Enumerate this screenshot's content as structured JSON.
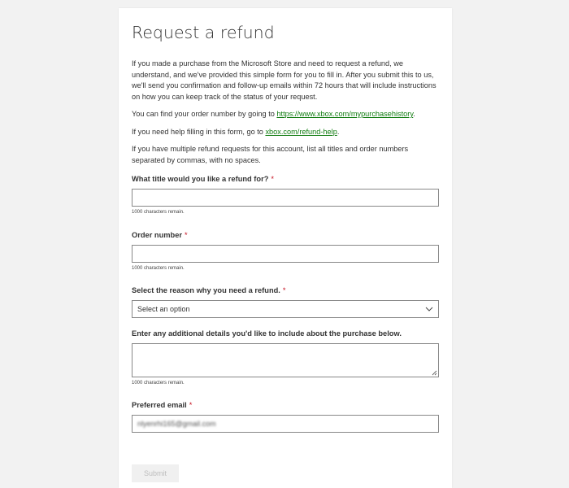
{
  "form": {
    "title": "Request a refund",
    "intro": {
      "p1": "If you made a purchase from the Microsoft Store and need to request a refund, we understand, and we've provided this simple form for you to fill in. After you submit this to us, we'll send you confirmation and follow-up emails within 72 hours that will include instructions on how you can keep track of the status of your request.",
      "p2_prefix": "You can find your order number by going to ",
      "p2_link": "https://www.xbox.com/mypurchasehistory",
      "p2_suffix": ".",
      "p3_prefix": "If you need help filling in this form, go to ",
      "p3_link": "xbox.com/refund-help",
      "p3_suffix": ".",
      "p4": "If you have multiple refund requests for this account, list all titles and order numbers separated by commas, with no spaces."
    },
    "fields": {
      "title_field": {
        "label": "What title would you like a refund for?",
        "required_mark": "*",
        "value": "",
        "hint": "1000 characters remain."
      },
      "order_field": {
        "label": "Order number",
        "required_mark": "*",
        "value": "",
        "hint": "1000 characters remain."
      },
      "reason_field": {
        "label": "Select the reason why you need a refund.",
        "required_mark": "*",
        "selected": "Select an option"
      },
      "details_field": {
        "label": "Enter any additional details you'd like to include about the purchase below.",
        "value": "",
        "hint": "1000 characters remain."
      },
      "email_field": {
        "label": "Preferred email",
        "required_mark": "*",
        "value": "nlyenrhi165@gmail.com"
      }
    },
    "submit_label": "Submit"
  },
  "colors": {
    "link": "#107c10",
    "required": "#c50f1f",
    "background": "#f2f2f2",
    "card": "#ffffff"
  },
  "icons": {
    "dropdown": "chevron-down-icon",
    "resize": "resize-grip-icon"
  }
}
